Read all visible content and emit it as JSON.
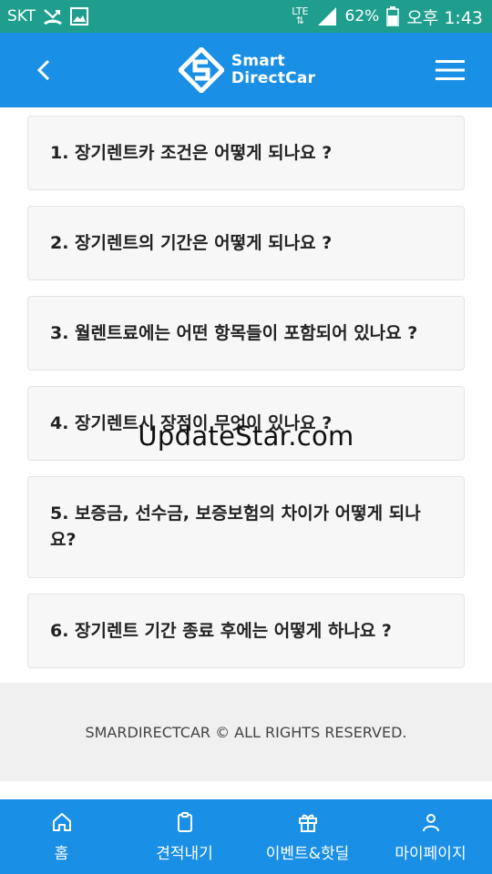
{
  "status_bar": {
    "carrier": "SKT",
    "network": "LTE",
    "battery": "62%",
    "time": "오후 1:43"
  },
  "header": {
    "logo_line1": "Smart",
    "logo_line2": "DirectCar"
  },
  "faq_items": [
    {
      "text": "1. 장기렌트카 조건은 어떻게 되나요 ?"
    },
    {
      "text": "2. 장기렌트의 기간은 어떻게 되나요 ?"
    },
    {
      "text": "3. 월렌트료에는 어떤 항목들이 포함되어 있나요 ?"
    },
    {
      "text": "4. 장기렌트시 장점이 무엇이 있나요 ?"
    },
    {
      "text": "5. 보증금, 선수금, 보증보험의 차이가 어떻게 되나요?"
    },
    {
      "text": "6. 장기렌트 기간 종료 후에는 어떻게 하나요 ?"
    }
  ],
  "watermark": "UpdateStar.com",
  "footer": {
    "copyright": "SMARDIRECTCAR © ALL RIGHTS RESERVED."
  },
  "bottom_nav": [
    {
      "label": "홈",
      "icon": "home-icon"
    },
    {
      "label": "견적내기",
      "icon": "clipboard-icon"
    },
    {
      "label": "이벤트&핫딜",
      "icon": "gift-icon"
    },
    {
      "label": "마이페이지",
      "icon": "user-icon"
    }
  ],
  "colors": {
    "status_bar": "#1f9e8e",
    "primary": "#1a8fe6",
    "card_bg": "#f7f7f7",
    "footer_bg": "#f0f0f0"
  }
}
